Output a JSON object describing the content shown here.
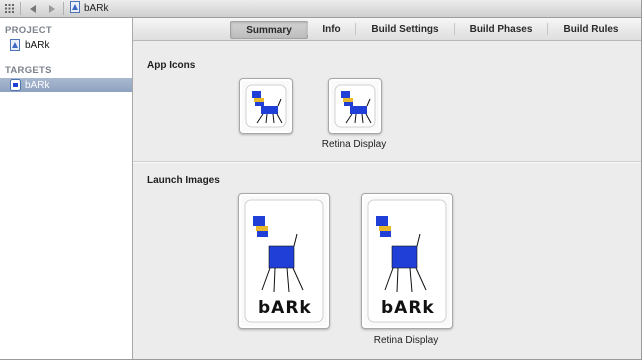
{
  "breadcrumb": {
    "project_name": "bARk"
  },
  "sidebar": {
    "project_header": "PROJECT",
    "project_item": "bARk",
    "targets_header": "TARGETS",
    "target_item": "bARk"
  },
  "tabs": [
    {
      "label": "Summary",
      "active": true
    },
    {
      "label": "Info",
      "active": false
    },
    {
      "label": "Build Settings",
      "active": false
    },
    {
      "label": "Build Phases",
      "active": false
    },
    {
      "label": "Build Rules",
      "active": false
    }
  ],
  "app_icons": {
    "title": "App Icons",
    "retina_caption": "Retina Display"
  },
  "launch_images": {
    "title": "Launch Images",
    "splash_text": "bARk",
    "retina_caption": "Retina Display"
  },
  "colors": {
    "selection": "#8ea2c0",
    "dog_body": "#1f3fd6",
    "dog_collar": "#e8b92a"
  },
  "icons": [
    "grid-icon",
    "back-arrow-icon",
    "forward-arrow-icon",
    "project-file-icon",
    "target-app-icon",
    "dog-drawing-icon"
  ]
}
